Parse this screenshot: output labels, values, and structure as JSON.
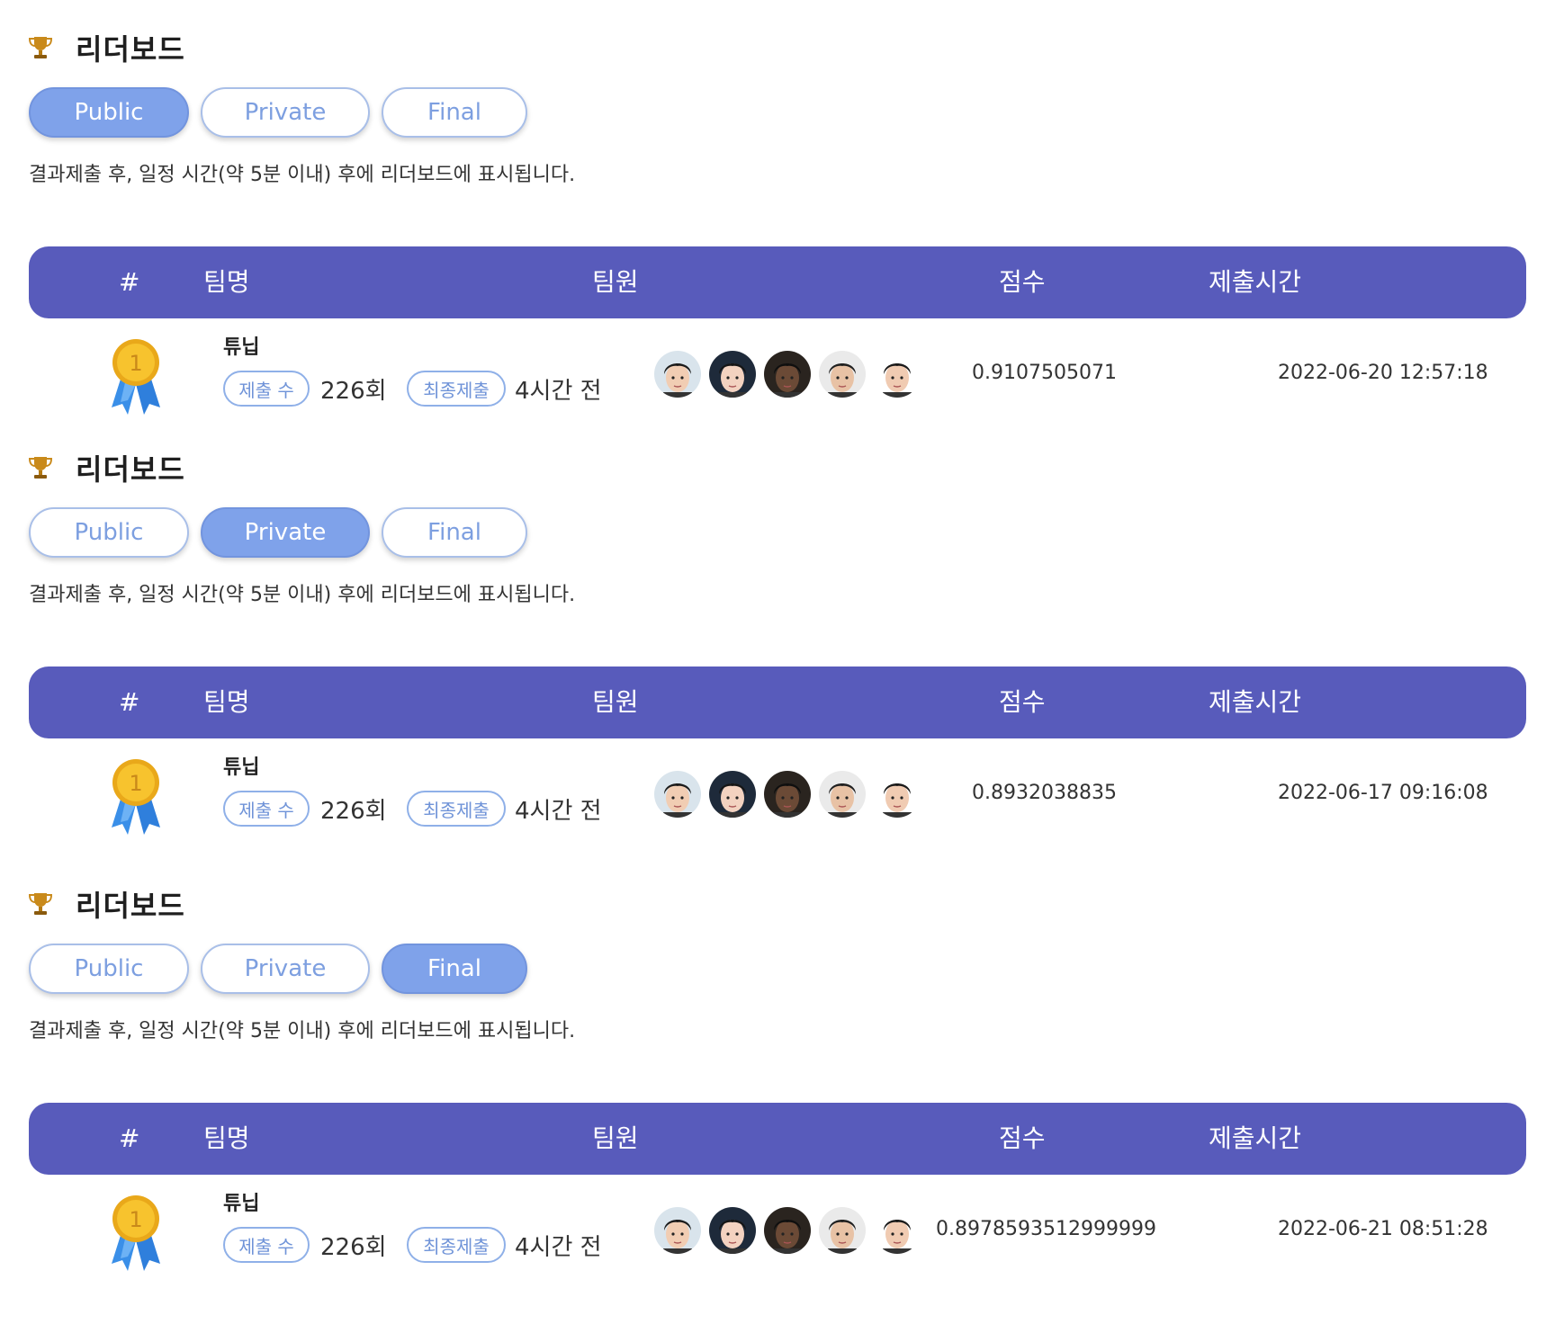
{
  "sections": [
    {
      "title": "리더보드",
      "tabs": [
        "Public",
        "Private",
        "Final"
      ],
      "active_tab": "Public",
      "note": "결과제출 후, 일정 시간(약 5분 이내) 후에 리더보드에 표시됩니다.",
      "headers": {
        "rank": "#",
        "team": "팀명",
        "members": "팀원",
        "score": "점수",
        "time": "제출시간"
      },
      "row": {
        "rank_badge": "1",
        "team_name": "튜닙",
        "submissions_label": "제출 수",
        "submissions_value": "226회",
        "final_label": "최종제출",
        "final_value": "4시간 전",
        "score": "0.9107505071",
        "submitted_at": "2022-06-20 12:57:18"
      }
    },
    {
      "title": "리더보드",
      "tabs": [
        "Public",
        "Private",
        "Final"
      ],
      "active_tab": "Private",
      "note": "결과제출 후, 일정 시간(약 5분 이내) 후에 리더보드에 표시됩니다.",
      "headers": {
        "rank": "#",
        "team": "팀명",
        "members": "팀원",
        "score": "점수",
        "time": "제출시간"
      },
      "row": {
        "rank_badge": "1",
        "team_name": "튜닙",
        "submissions_label": "제출 수",
        "submissions_value": "226회",
        "final_label": "최종제출",
        "final_value": "4시간 전",
        "score": "0.8932038835",
        "submitted_at": "2022-06-17 09:16:08"
      }
    },
    {
      "title": "리더보드",
      "tabs": [
        "Public",
        "Private",
        "Final"
      ],
      "active_tab": "Final",
      "note": "결과제출 후, 일정 시간(약 5분 이내) 후에 리더보드에 표시됩니다.",
      "headers": {
        "rank": "#",
        "team": "팀명",
        "members": "팀원",
        "score": "점수",
        "time": "제출시간"
      },
      "row": {
        "rank_badge": "1",
        "team_name": "튜닙",
        "submissions_label": "제출 수",
        "submissions_value": "226회",
        "final_label": "최종제출",
        "final_value": "4시간 전",
        "score": "0.8978593512999999",
        "submitted_at": "2022-06-21 08:51:28"
      }
    }
  ],
  "colors": {
    "header_bg": "#585bbb",
    "tab_active": "#7fa2ea",
    "tab_border": "#a9bfe8",
    "chip_border": "#8fb0e8",
    "medal_gold": "#f7c32e",
    "ribbon_blue": "#3a8fe8"
  },
  "icons": {
    "title_icon": "trophy-icon",
    "rank_icon": "medal-icon",
    "member_icon": "avatar"
  }
}
